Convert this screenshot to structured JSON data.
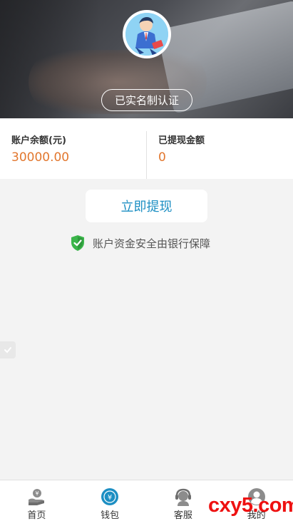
{
  "header": {
    "verified_label": "已实名制认证"
  },
  "balance": {
    "account_label": "账户余额(元)",
    "account_value": "30000.00",
    "withdrawn_label": "已提现金额",
    "withdrawn_value": "0"
  },
  "actions": {
    "withdraw_label": "立即提现"
  },
  "safety": {
    "text": "账户资金安全由银行保障"
  },
  "tabbar": {
    "items": [
      {
        "label": "首页",
        "icon": "home-icon"
      },
      {
        "label": "钱包",
        "icon": "wallet-icon"
      },
      {
        "label": "客服",
        "icon": "support-icon"
      },
      {
        "label": "我的",
        "icon": "user-icon"
      }
    ]
  },
  "watermark": "cxy5.com",
  "colors": {
    "accent": "#1d8fc3",
    "amount": "#e2772e",
    "shield": "#3bb54a"
  }
}
